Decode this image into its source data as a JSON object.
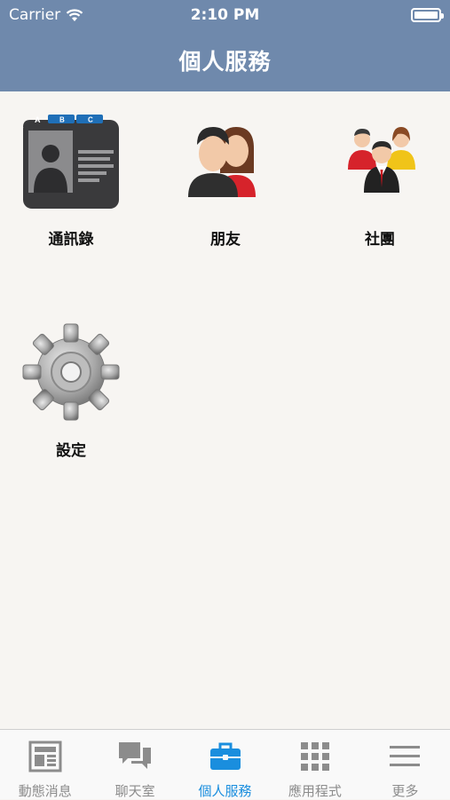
{
  "status_bar": {
    "carrier": "Carrier",
    "time": "2:10 PM"
  },
  "header": {
    "title": "個人服務"
  },
  "services": [
    {
      "label": "通訊錄",
      "icon": "contacts-card-icon"
    },
    {
      "label": "朋友",
      "icon": "friends-icon"
    },
    {
      "label": "社團",
      "icon": "group-people-icon"
    },
    {
      "label": "設定",
      "icon": "gear-icon"
    }
  ],
  "contacts_tabs": [
    "A",
    "B",
    "C"
  ],
  "tabbar": {
    "items": [
      {
        "label": "動態消息",
        "icon": "newspaper-icon",
        "active": false
      },
      {
        "label": "聊天室",
        "icon": "chat-bubbles-icon",
        "active": false
      },
      {
        "label": "個人服務",
        "icon": "briefcase-icon",
        "active": true
      },
      {
        "label": "應用程式",
        "icon": "grid-apps-icon",
        "active": false
      },
      {
        "label": "更多",
        "icon": "menu-lines-icon",
        "active": false
      }
    ]
  },
  "colors": {
    "header": "#6f89ac",
    "active_tab": "#1a8ede",
    "inactive_tab": "#8c8c8c",
    "background": "#f7f5f2"
  }
}
